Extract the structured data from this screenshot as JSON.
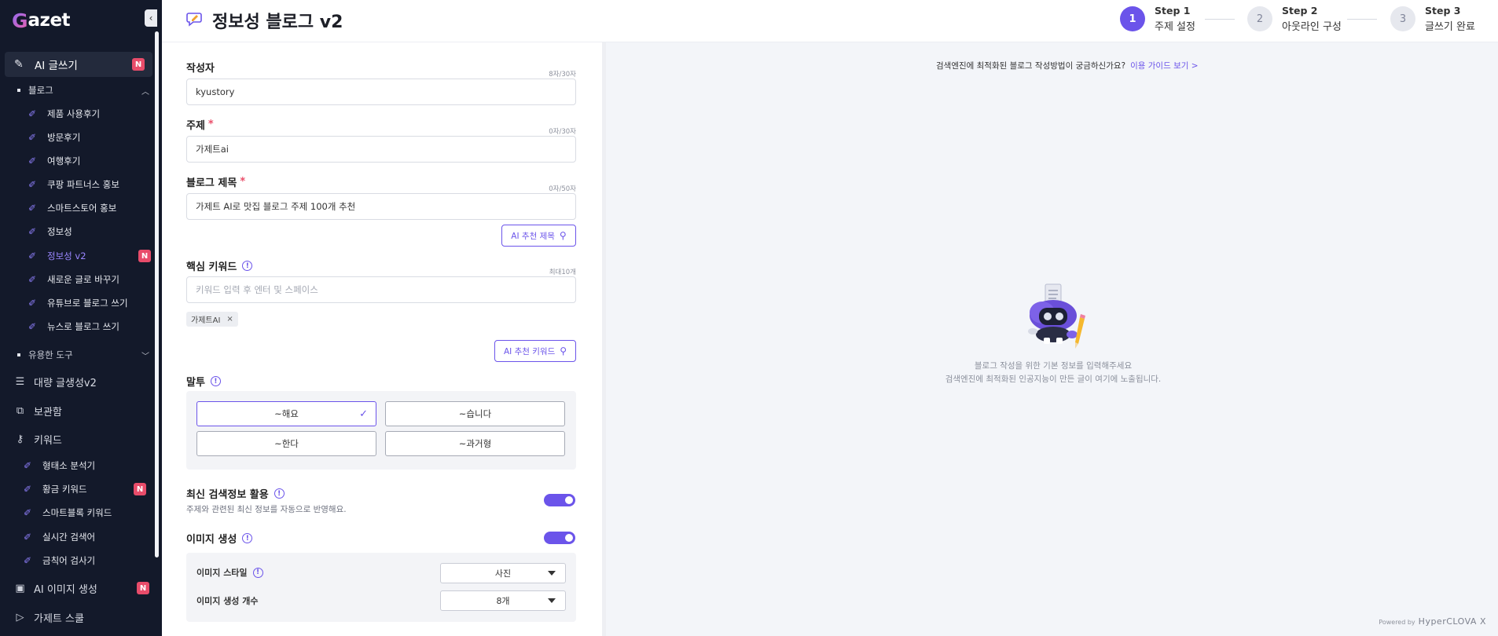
{
  "app": {
    "logo_first": "G",
    "logo_rest": "azet"
  },
  "sidebar": {
    "top_item": {
      "label": "AI 글쓰기",
      "badge": "N"
    },
    "blog_group": "블로그",
    "blog_items": [
      {
        "label": "제품 사용후기",
        "badge": ""
      },
      {
        "label": "방문후기",
        "badge": ""
      },
      {
        "label": "여행후기",
        "badge": ""
      },
      {
        "label": "쿠팡 파트너스 홍보",
        "badge": ""
      },
      {
        "label": "스마트스토어 홍보",
        "badge": ""
      },
      {
        "label": "정보성",
        "badge": ""
      },
      {
        "label": "정보성 v2",
        "badge": "N"
      },
      {
        "label": "새로운 글로 바꾸기",
        "badge": ""
      },
      {
        "label": "유튜브로 블로그 쓰기",
        "badge": ""
      },
      {
        "label": "뉴스로 블로그 쓰기",
        "badge": ""
      }
    ],
    "tools_group": "유용한 도구",
    "bulk": "대량 글생성v2",
    "storage": "보관함",
    "keyword": "키워드",
    "keyword_items": [
      {
        "label": "형태소 분석기",
        "badge": ""
      },
      {
        "label": "황금 키워드",
        "badge": "N"
      },
      {
        "label": "스마트블록 키워드",
        "badge": ""
      },
      {
        "label": "실시간 검색어",
        "badge": ""
      },
      {
        "label": "금칙어 검사기",
        "badge": ""
      }
    ],
    "ai_image": {
      "label": "AI 이미지 생성",
      "badge": "N"
    },
    "school": "가제트 스쿨"
  },
  "header": {
    "title": "정보성 블로그 v2",
    "steps": [
      {
        "circle": "1",
        "num": "Step 1",
        "name": "주제 설정"
      },
      {
        "circle": "2",
        "num": "Step 2",
        "name": "아웃라인 구성"
      },
      {
        "circle": "3",
        "num": "Step 3",
        "name": "글쓰기 완료"
      }
    ]
  },
  "form": {
    "author": {
      "label": "작성자",
      "count": "8자/30자",
      "value": "kyustory"
    },
    "topic": {
      "label": "주제",
      "required": "*",
      "count": "0자/30자",
      "value": "가제트ai"
    },
    "blog_title": {
      "label": "블로그 제목",
      "required": "*",
      "count": "0자/50자",
      "value": "가제트 AI로 맛집 블로그 주제 100개 추천",
      "ai_button": "AI 추천 제목"
    },
    "keywords": {
      "label": "핵심 키워드",
      "count": "최대10개",
      "placeholder": "키워드 입력 후 엔터 및 스페이스",
      "chip": "가제트AI",
      "chip_x": "×",
      "ai_button": "AI 추천 키워드"
    },
    "tone": {
      "label": "말투",
      "options": [
        "~해요",
        "~습니다",
        "~한다",
        "~과거형"
      ],
      "check": "✓"
    },
    "latest": {
      "label": "최신 검색정보 활용",
      "desc": "주제와 관련된 최신 정보를 자동으로 반영해요."
    },
    "image": {
      "label": "이미지 생성",
      "style_label": "이미지 스타일",
      "style_value": "사진",
      "count_label": "이미지 생성 개수",
      "count_value": "8개"
    }
  },
  "preview": {
    "guide_text": "검색엔진에 최적화된 블로그 작성방법이 궁금하신가요?",
    "guide_link": "이용 가이드 보기 >",
    "empty_line1": "블로그 작성을 위한 기본 정보를 입력해주세요",
    "empty_line2": "검색엔진에 최적화된 인공지능이 만든 글이 여기에 노출됩니다.",
    "powered_prefix": "Powered by",
    "powered_brand": "HyperCLOVA X"
  },
  "colors": {
    "accent": "#6b54ea",
    "sidebar_bg": "#13192a",
    "badge": "#e84c6a"
  }
}
